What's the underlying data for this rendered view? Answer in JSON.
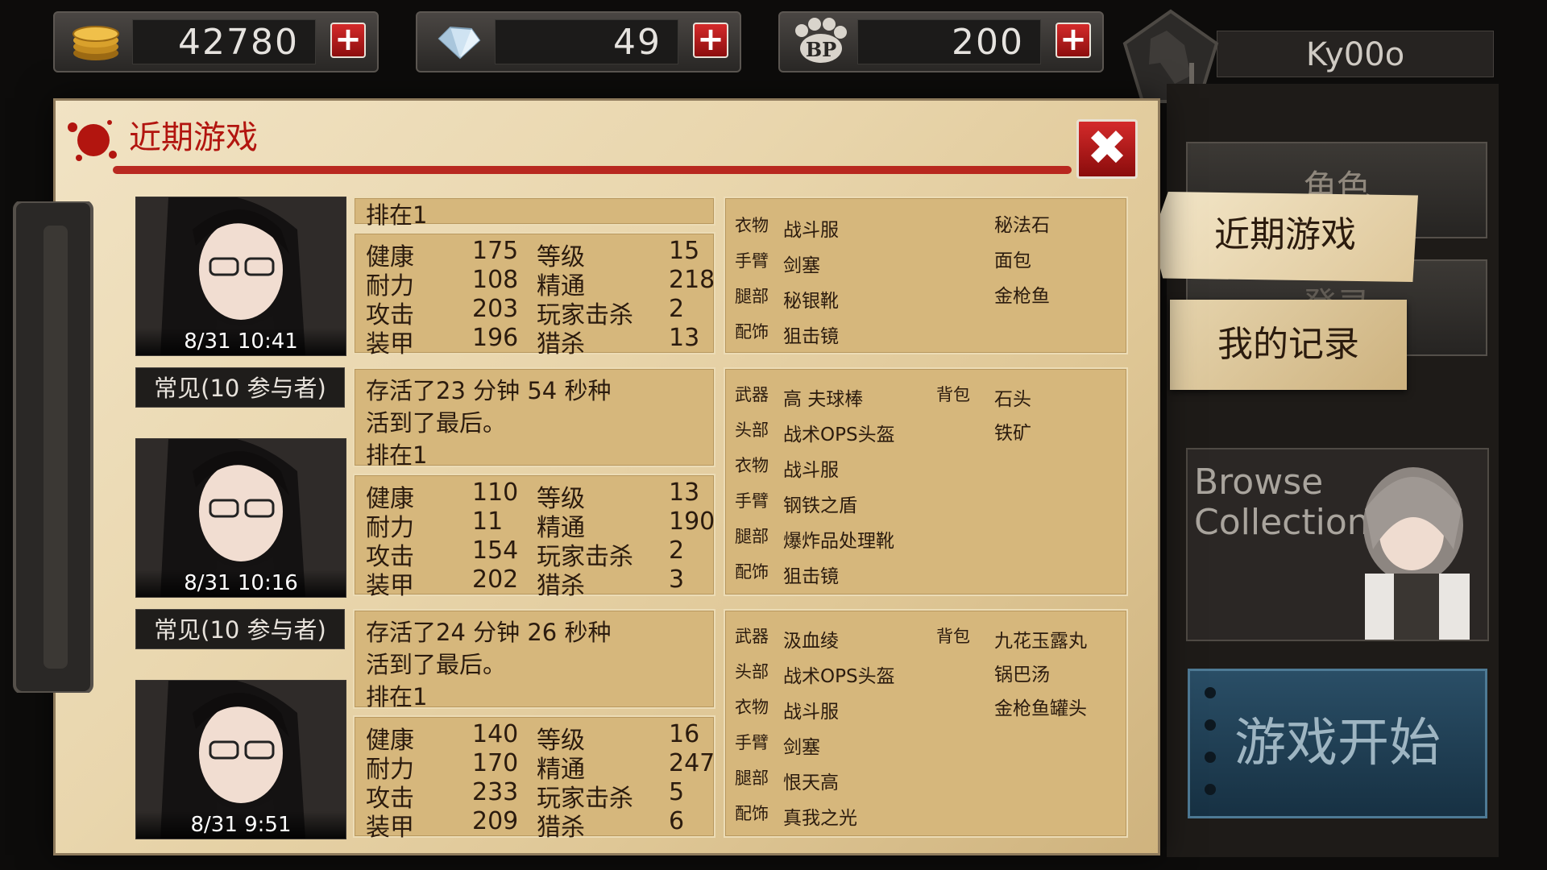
{
  "resources": {
    "gold": "42780",
    "gems": "49",
    "bp": "200",
    "bp_label": "BP",
    "add": "+"
  },
  "user": {
    "name": "Ky00o"
  },
  "panel": {
    "title": "近期游戏",
    "close": "✖"
  },
  "labels": {
    "health": "健康",
    "stamina": "耐力",
    "attack": "攻击",
    "armor": "装甲",
    "level": "等级",
    "mastery": "精通",
    "player_kills": "玩家击杀",
    "hunt_kills": "猎杀",
    "slot_weapon": "武器",
    "slot_head": "头部",
    "slot_clothes": "衣物",
    "slot_arm": "手臂",
    "slot_leg": "腿部",
    "slot_accessory": "配饰",
    "slot_backpack": "背包"
  },
  "games": [
    {
      "date": "8/31 10:41",
      "summary": [
        "排在1"
      ],
      "stats": {
        "health": "175",
        "stamina": "108",
        "attack": "203",
        "armor": "196",
        "level": "15",
        "mastery": "218",
        "player_kills": "2",
        "hunt_kills": "13"
      },
      "equip": {
        "clothes": "战斗服",
        "arm": "剑塞",
        "leg": "秘银靴",
        "accessory": "狙击镜"
      },
      "bag": [
        "秘法石",
        "面包",
        "金枪鱼"
      ]
    },
    {
      "mode": "常见(10  参与者)",
      "date": "8/31 10:16",
      "summary": [
        "存活了23  分钟  54  秒种",
        "活到了最后。",
        "排在1"
      ],
      "stats": {
        "health": "110",
        "stamina": "11",
        "attack": "154",
        "armor": "202",
        "level": "13",
        "mastery": "190",
        "player_kills": "2",
        "hunt_kills": "3"
      },
      "equip": {
        "weapon": "高   夫球棒",
        "head": "战术OPS头盔",
        "clothes": "战斗服",
        "arm": "钢铁之盾",
        "leg": "爆炸品处理靴",
        "accessory": "狙击镜"
      },
      "bag": [
        "石头",
        "铁矿"
      ]
    },
    {
      "mode": "常见(10  参与者)",
      "date": "8/31 9:51",
      "summary": [
        "存活了24  分钟  26  秒种",
        "活到了最后。",
        "排在1"
      ],
      "stats": {
        "health": "140",
        "stamina": "170",
        "attack": "233",
        "armor": "209",
        "level": "16",
        "mastery": "247",
        "player_kills": "5",
        "hunt_kills": "6"
      },
      "equip": {
        "weapon": "汲血绫",
        "head": "战术OPS头盔",
        "clothes": "战斗服",
        "arm": "剑塞",
        "leg": "恨天高",
        "accessory": "真我之光"
      },
      "bag": [
        "九花玉露丸",
        "锅巴汤",
        "金枪鱼罐头"
      ]
    }
  ],
  "side": {
    "character": "角色",
    "recent": "近期游戏",
    "my_records": "我的记录",
    "browse_1": "Browse",
    "browse_2": "Collection",
    "start": "游戏开始",
    "hidden_btn": "登录"
  },
  "colors": {
    "accent_red": "#b2150f",
    "parchment": "#e9d6ad",
    "start_blue": "#1f3f55"
  }
}
